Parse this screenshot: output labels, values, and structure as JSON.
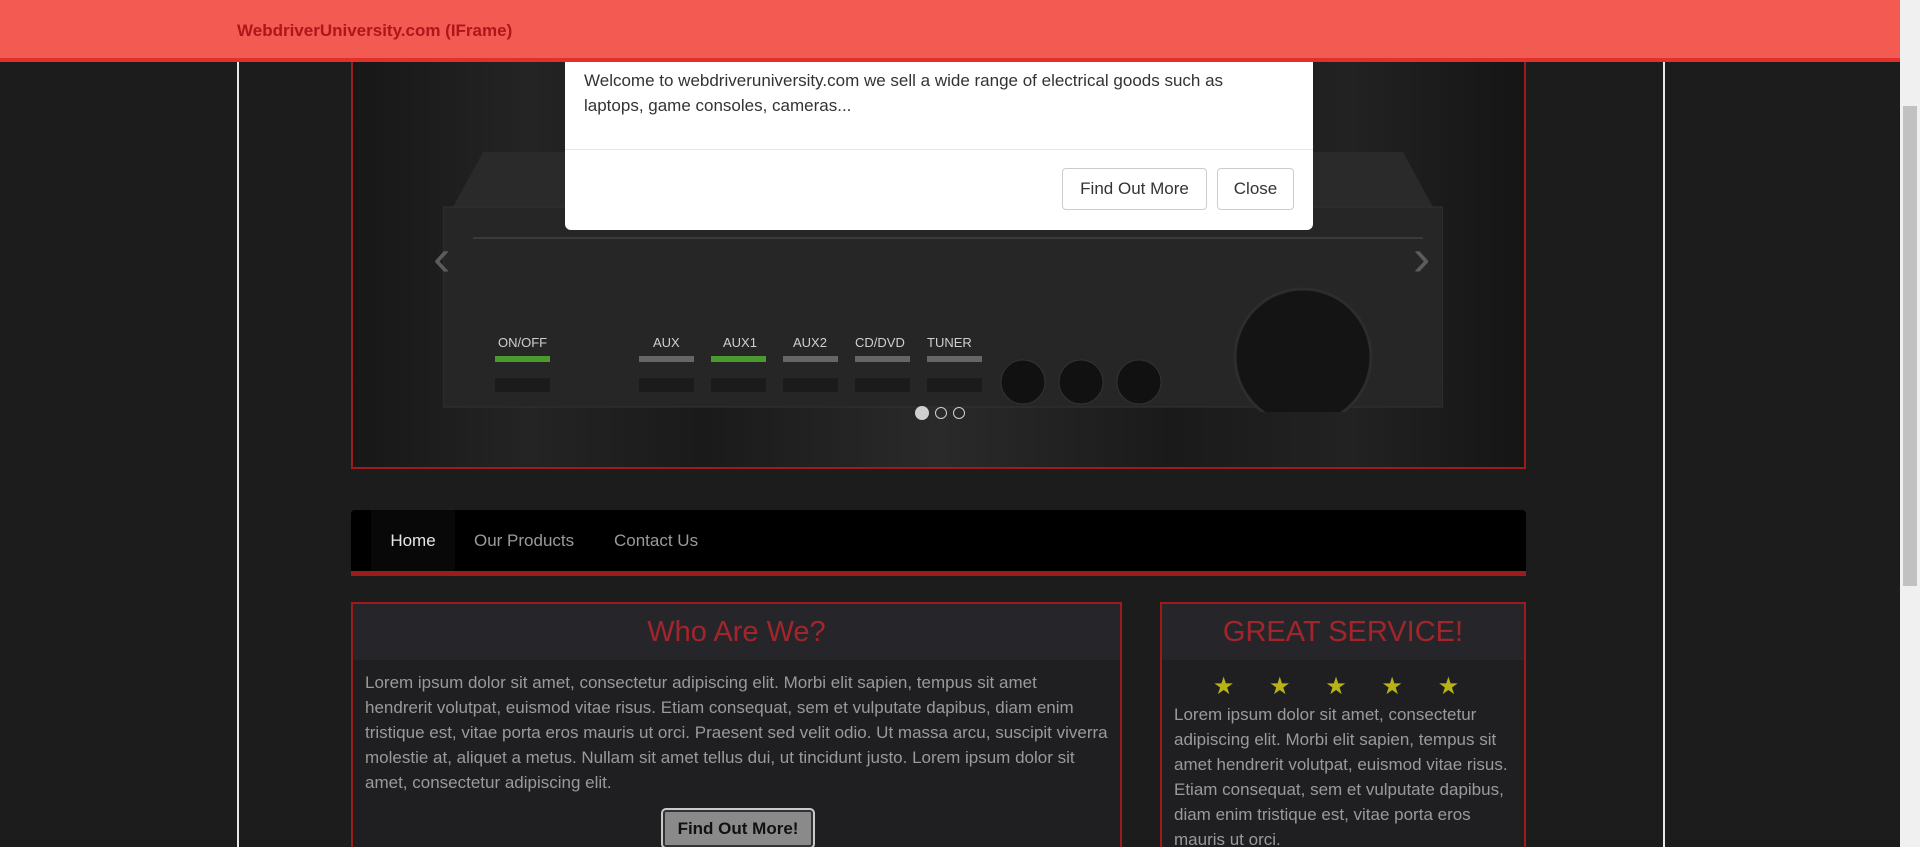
{
  "navbar": {
    "brand": "WebdriverUniversity.com (IFrame)"
  },
  "modal": {
    "body_text": "Welcome to webdriveruniversity.com we sell a wide range of electrical goods such as laptops, game consoles, cameras...",
    "find_out_more_label": "Find Out More",
    "close_label": "Close"
  },
  "carousel": {
    "amp_labels": [
      "ON/OFF",
      "AUX",
      "AUX1",
      "AUX2",
      "CD/DVD",
      "TUNER"
    ],
    "indicators": 3,
    "active_index": 0
  },
  "nav": {
    "items": [
      {
        "label": "Home",
        "active": true
      },
      {
        "label": "Our Products"
      },
      {
        "label": "Contact Us"
      }
    ]
  },
  "who": {
    "title": "Who Are We?",
    "text": "Lorem ipsum dolor sit amet, consectetur adipiscing elit. Morbi elit sapien, tempus sit amet hendrerit volutpat, euismod vitae risus. Etiam consequat, sem et vulputate dapibus, diam enim tristique est, vitae porta eros mauris ut orci. Praesent sed velit odio. Ut massa arcu, suscipit viverra molestie at, aliquet a metus. Nullam sit amet tellus dui, ut tincidunt justo. Lorem ipsum dolor sit amet, consectetur adipiscing elit.",
    "button_label": "Find Out More!"
  },
  "service": {
    "title": "GREAT SERVICE!",
    "rating": 5,
    "stars": "★ ★ ★ ★ ★",
    "text": "Lorem ipsum dolor sit amet, consectetur adipiscing elit. Morbi elit sapien, tempus sit amet hendrerit volutpat, euismod vitae risus. Etiam consequat, sem et vulputate dapibus, diam enim tristique est, vitae porta eros mauris ut orci."
  },
  "colors": {
    "accent": "#9c1b1b",
    "navbar_bg": "#f25a52",
    "brand_text": "#b0151a",
    "star": "#b8b217"
  }
}
